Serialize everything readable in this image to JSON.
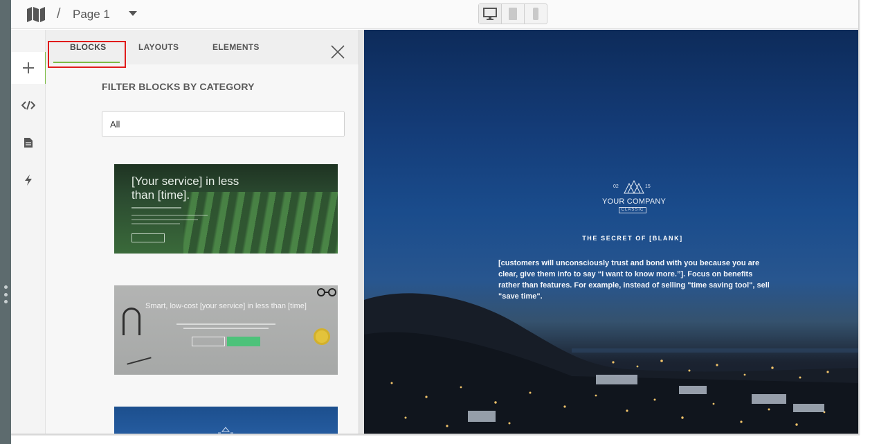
{
  "header": {
    "separator": "/",
    "page_name": "Page 1",
    "devices": [
      "desktop-icon",
      "tablet-icon",
      "phone-icon"
    ]
  },
  "rail": {
    "items": [
      "add-icon",
      "code-icon",
      "page-icon",
      "bolt-icon"
    ],
    "active": "add-icon"
  },
  "panel": {
    "tabs": [
      {
        "label": "BLOCKS"
      },
      {
        "label": "LAYOUTS"
      },
      {
        "label": "ELEMENTS"
      }
    ],
    "active_tab": "BLOCKS",
    "filter_heading": "FILTER BLOCKS BY CATEGORY",
    "filter_value": "All",
    "thumbnails": [
      {
        "title": "[Your service] in less than [time]."
      },
      {
        "title": "Smart, low-cost [your service] in less than [time]"
      }
    ]
  },
  "canvas": {
    "logo": {
      "left_number": "02",
      "right_number": "15",
      "company": "YOUR COMPANY",
      "tag": "CLASSIC"
    },
    "headline": "THE SECRET OF [BLANK]",
    "body": "[customers will unconsciously trust and bond with you because you are clear, give them info to say “I want to know more.”]. Focus on benefits rather than features. For example, instead of selling \"time saving tool\", sell \"save time\"."
  },
  "colors": {
    "accent": "#7cbb45",
    "highlight": "#e01b1b",
    "green_button": "#4dc27a"
  }
}
